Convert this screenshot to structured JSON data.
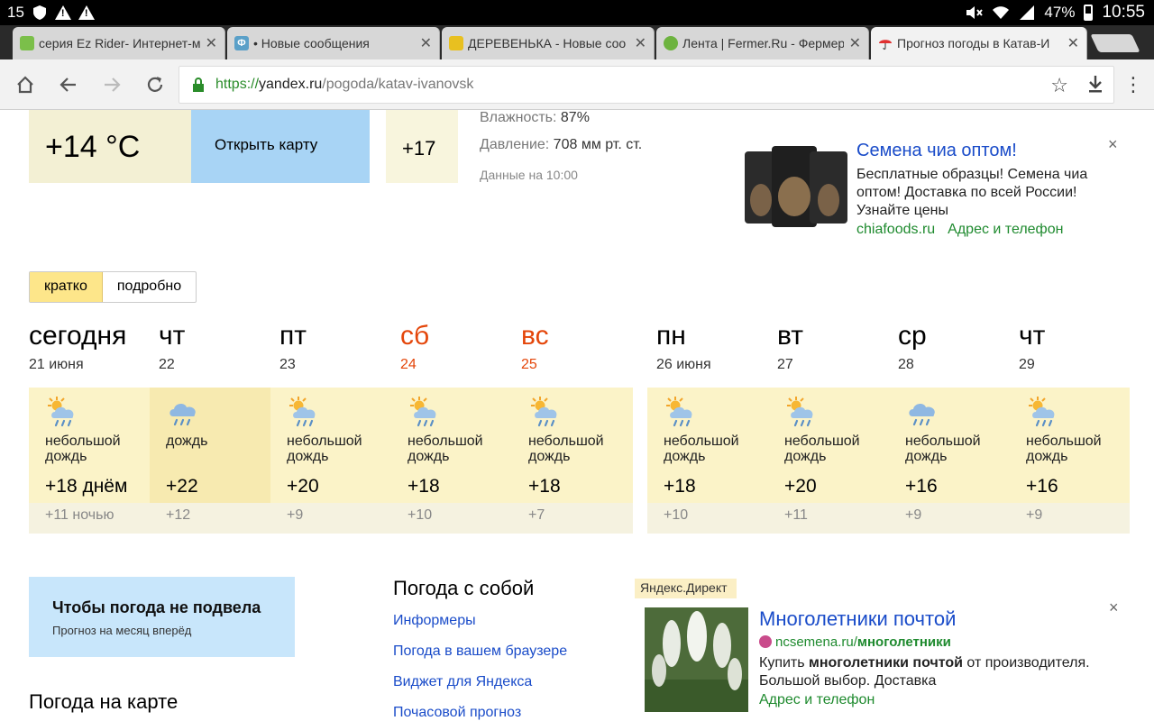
{
  "status_bar": {
    "left_text": "15",
    "battery": "47%",
    "time": "10:55"
  },
  "tabs": [
    {
      "title": "серия Ez Rider- Интернет-м",
      "favicon_color": "#7bbf4a",
      "favicon": ""
    },
    {
      "title": "• Новые сообщения",
      "favicon_color": "#5aa0c8",
      "favicon": "Ф"
    },
    {
      "title": "ДЕРЕВЕНЬКА - Новые соо",
      "favicon_color": "#e8c020",
      "favicon": ""
    },
    {
      "title": "Лента | Fermer.Ru - Фермер",
      "favicon_color": "#6db33f",
      "favicon": ""
    },
    {
      "title": "Прогноз погоды в Катав-И",
      "favicon_color": "#e03030",
      "favicon": ""
    }
  ],
  "address": {
    "scheme": "https://",
    "host": "yandex.ru",
    "path": "/pogoda/katav-ivanovsk"
  },
  "current": {
    "temp": "+14 °C",
    "map_button": "Открыть карту",
    "next_temp": "+17",
    "humidity_label": "Влажность:",
    "humidity_value": "87%",
    "pressure_label": "Давление:",
    "pressure_value": "708 мм рт. ст.",
    "data_time": "Данные на 10:00"
  },
  "ad_top": {
    "headline": "Семена чиа оптом!",
    "body": "Бесплатные образцы! Семена чиа оптом! Доставка по всей России! Узнайте цены",
    "site": "chiafoods.ru",
    "contact": "Адрес и телефон",
    "close": "×"
  },
  "toggle": {
    "brief": "кратко",
    "detailed": "подробно"
  },
  "days": [
    {
      "name": "сегодня",
      "date": "21 июня",
      "weekend": false
    },
    {
      "name": "чт",
      "date": "22",
      "weekend": false
    },
    {
      "name": "пт",
      "date": "23",
      "weekend": false
    },
    {
      "name": "сб",
      "date": "24",
      "weekend": true
    },
    {
      "name": "вс",
      "date": "25",
      "weekend": true
    },
    {
      "name": "пн",
      "date": "26 июня",
      "weekend": false
    },
    {
      "name": "вт",
      "date": "27",
      "weekend": false
    },
    {
      "name": "ср",
      "date": "28",
      "weekend": false
    },
    {
      "name": "чт",
      "date": "29",
      "weekend": false
    }
  ],
  "forecast": [
    {
      "icon": "sun-cloud-rain-icon",
      "condition": "небольшой дождь",
      "day": "+18 днём",
      "night": "+11 ночью"
    },
    {
      "icon": "cloud-rain-icon",
      "condition": "дождь",
      "day": "+22",
      "night": "+12"
    },
    {
      "icon": "sun-cloud-rain-icon",
      "condition": "небольшой дождь",
      "day": "+20",
      "night": "+9"
    },
    {
      "icon": "sun-cloud-rain-icon",
      "condition": "небольшой дождь",
      "day": "+18",
      "night": "+10"
    },
    {
      "icon": "sun-cloud-rain-icon",
      "condition": "небольшой дождь",
      "day": "+18",
      "night": "+7"
    },
    {
      "icon": "sun-cloud-rain-icon",
      "condition": "небольшой дождь",
      "day": "+18",
      "night": "+10"
    },
    {
      "icon": "sun-cloud-rain-icon",
      "condition": "небольшой дождь",
      "day": "+20",
      "night": "+11"
    },
    {
      "icon": "cloud-rain-icon",
      "condition": "небольшой дождь",
      "day": "+16",
      "night": "+9"
    },
    {
      "icon": "sun-cloud-rain-icon",
      "condition": "небольшой дождь",
      "day": "+16",
      "night": "+9"
    }
  ],
  "promo": {
    "title": "Чтобы погода не подвела",
    "subtitle": "Прогноз на месяц вперёд"
  },
  "map_heading": "Погода на карте",
  "weather_links": {
    "heading": "Погода с собой",
    "items": [
      "Информеры",
      "Погода в вашем браузере",
      "Виджет для Яндекса",
      "Почасовой прогноз"
    ]
  },
  "ad_bottom": {
    "label": "Яндекс.Директ",
    "headline": "Многолетники почтой",
    "site_host": "ncsemena.ru/",
    "site_path": "многолетники",
    "body_prefix": "Купить ",
    "body_bold": "многолетники почтой",
    "body_suffix": " от производителя. Большой выбор. Доставка",
    "contact": "Адрес и телефон",
    "close": "×"
  },
  "colors": {
    "accent_blue": "#1a4cc9",
    "ad_green": "#1e8a2e",
    "weekend": "#e4460a",
    "toggle_on": "#fde68a"
  }
}
